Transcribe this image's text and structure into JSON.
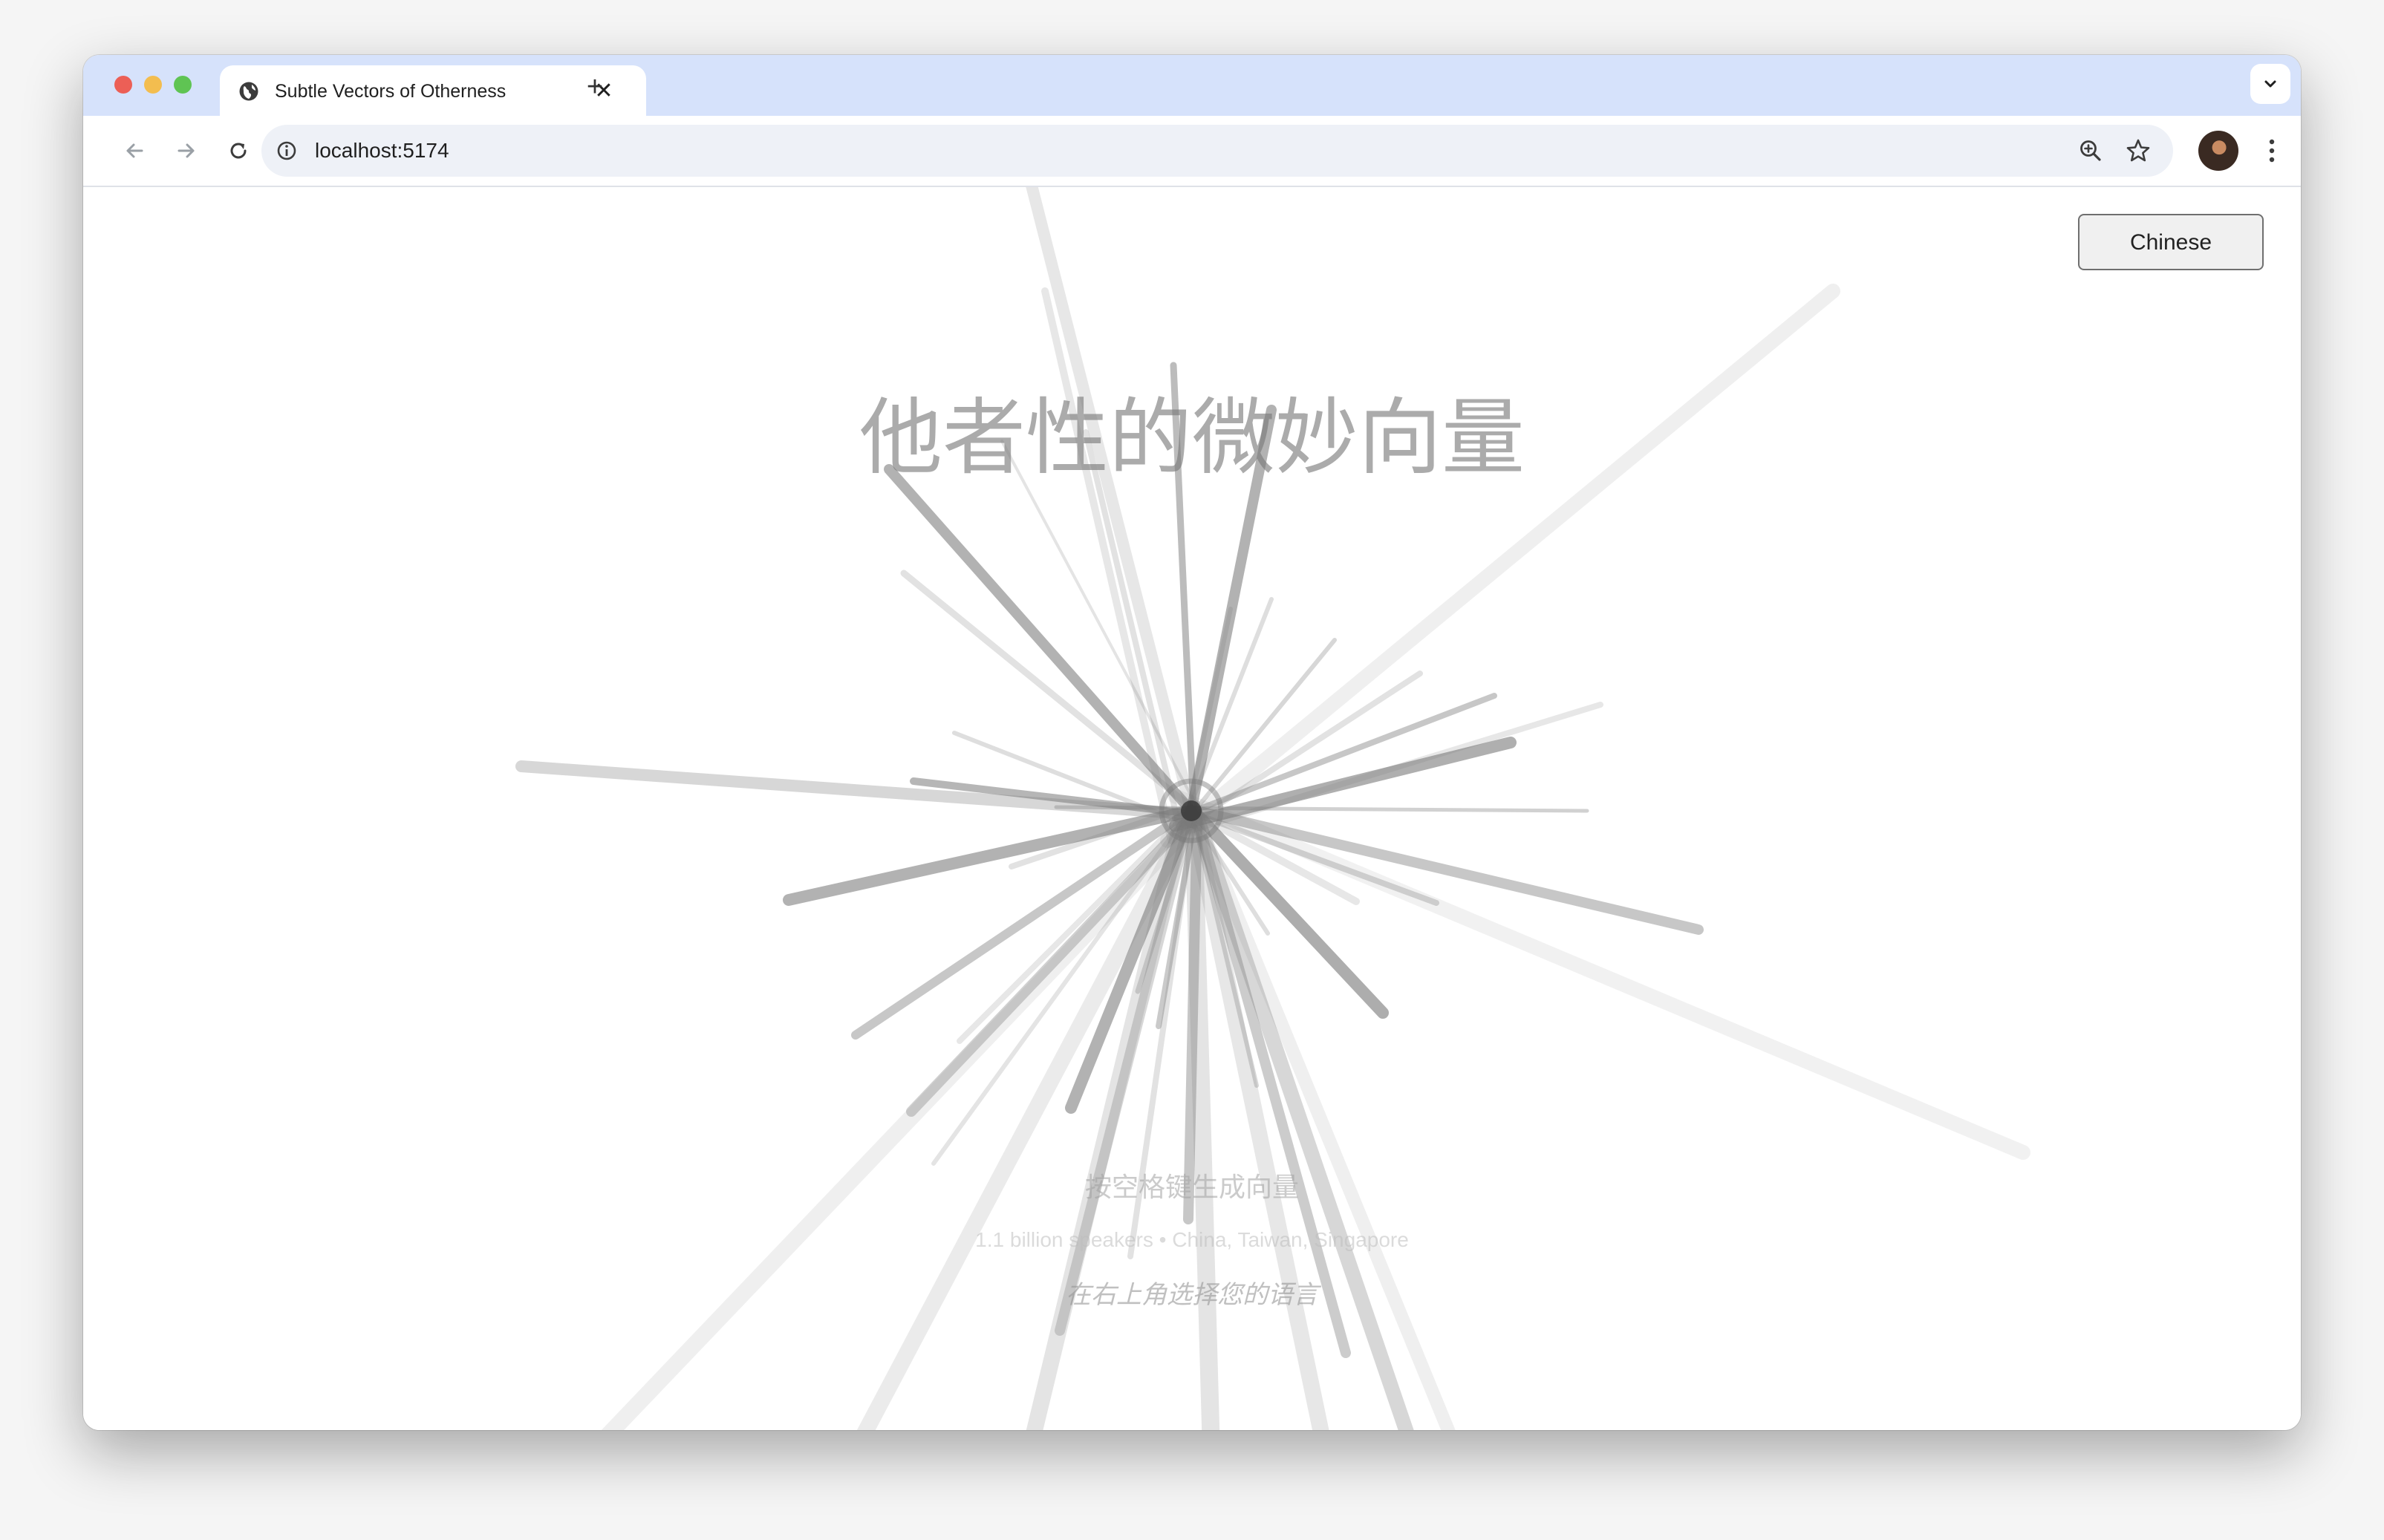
{
  "browser": {
    "tab_title": "Subtle Vectors of Otherness",
    "close_glyph": "✕",
    "new_tab_glyph": "+",
    "url": "localhost:5174",
    "icons": [
      "globe-icon",
      "close-icon",
      "plus-icon",
      "chevron-down-icon",
      "back-arrow-icon",
      "forward-arrow-icon",
      "reload-icon",
      "info-icon",
      "zoom-icon",
      "star-icon",
      "avatar",
      "kebab-menu-icon"
    ],
    "colors": {
      "tab_strip": "#d6e2fb",
      "omnibox": "#eef1f7",
      "traffic_red": "#ec5f56",
      "traffic_yellow": "#f3bd4f",
      "traffic_green": "#5fc453"
    }
  },
  "page": {
    "language_button": "Chinese",
    "title": "他者性的微妙向量",
    "instruction": "按空格键生成向量",
    "speakers": "1.1 billion speakers • China, Taiwan, Singapore",
    "language_hint": "在右上角选择您的语言",
    "colors": {
      "background": "#ffffff",
      "vector": "#7a7a7a"
    }
  }
}
